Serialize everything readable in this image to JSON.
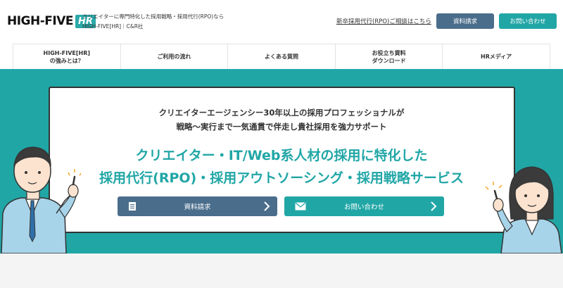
{
  "header": {
    "logo_text": "HIGH-FIVE",
    "logo_badge": "HR",
    "tagline_line1": "クリエイターに専門特化した採用戦略・採用代行(RPO)なら",
    "tagline_line2": "HIGH-FIVE[HR]｜C&R社",
    "consult_link": "新卒採用代行(RPO)ご相談はこちら",
    "doc_button": "資料請求",
    "contact_button": "お問い合わせ"
  },
  "nav": {
    "items": [
      {
        "line1": "HIGH-FIVE[HR]",
        "line2": "の強みとは？"
      },
      {
        "line1": "ご利用の流れ",
        "line2": ""
      },
      {
        "line1": "よくある質問",
        "line2": ""
      },
      {
        "line1": "お役立ち資料",
        "line2": "ダウンロード"
      },
      {
        "line1": "HRメディア",
        "line2": ""
      }
    ]
  },
  "hero": {
    "sub_line1": "クリエイターエージェンシー30年以上の採用プロフェッショナルが",
    "sub_line2": "戦略〜実行まで一気通貫で伴走し貴社採用を強力サポート",
    "headline_line1": "クリエイター・IT/Web系人材の採用に特化した",
    "headline_line2": "採用代行(RPO)・採用アウトソーシング・採用戦略サービス",
    "cta_doc": "資料請求",
    "cta_mail": "お問い合わせ"
  },
  "colors": {
    "teal": "#21a6a6",
    "navy": "#4a6d8c"
  },
  "icons": {
    "document": "document-icon",
    "mail": "mail-icon",
    "chevron": "chevron-right-icon"
  }
}
